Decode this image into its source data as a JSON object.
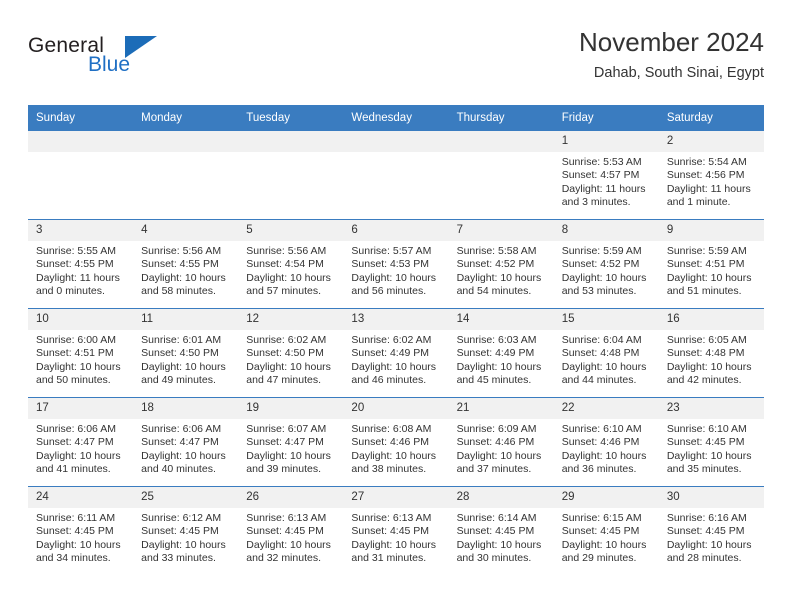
{
  "brand": {
    "name_part1": "General",
    "name_part2": "Blue",
    "accent_color": "#1c6cb8"
  },
  "header": {
    "title": "November 2024",
    "subtitle": "Dahab, South Sinai, Egypt"
  },
  "calendar": {
    "header_bg": "#3a7cc0",
    "daynum_bg": "#f1f1f1",
    "weekdays": [
      "Sunday",
      "Monday",
      "Tuesday",
      "Wednesday",
      "Thursday",
      "Friday",
      "Saturday"
    ],
    "weeks": [
      [
        {
          "day": "",
          "sunrise": "",
          "sunset": "",
          "daylight1": "",
          "daylight2": ""
        },
        {
          "day": "",
          "sunrise": "",
          "sunset": "",
          "daylight1": "",
          "daylight2": ""
        },
        {
          "day": "",
          "sunrise": "",
          "sunset": "",
          "daylight1": "",
          "daylight2": ""
        },
        {
          "day": "",
          "sunrise": "",
          "sunset": "",
          "daylight1": "",
          "daylight2": ""
        },
        {
          "day": "",
          "sunrise": "",
          "sunset": "",
          "daylight1": "",
          "daylight2": ""
        },
        {
          "day": "1",
          "sunrise": "Sunrise: 5:53 AM",
          "sunset": "Sunset: 4:57 PM",
          "daylight1": "Daylight: 11 hours",
          "daylight2": "and 3 minutes."
        },
        {
          "day": "2",
          "sunrise": "Sunrise: 5:54 AM",
          "sunset": "Sunset: 4:56 PM",
          "daylight1": "Daylight: 11 hours",
          "daylight2": "and 1 minute."
        }
      ],
      [
        {
          "day": "3",
          "sunrise": "Sunrise: 5:55 AM",
          "sunset": "Sunset: 4:55 PM",
          "daylight1": "Daylight: 11 hours",
          "daylight2": "and 0 minutes."
        },
        {
          "day": "4",
          "sunrise": "Sunrise: 5:56 AM",
          "sunset": "Sunset: 4:55 PM",
          "daylight1": "Daylight: 10 hours",
          "daylight2": "and 58 minutes."
        },
        {
          "day": "5",
          "sunrise": "Sunrise: 5:56 AM",
          "sunset": "Sunset: 4:54 PM",
          "daylight1": "Daylight: 10 hours",
          "daylight2": "and 57 minutes."
        },
        {
          "day": "6",
          "sunrise": "Sunrise: 5:57 AM",
          "sunset": "Sunset: 4:53 PM",
          "daylight1": "Daylight: 10 hours",
          "daylight2": "and 56 minutes."
        },
        {
          "day": "7",
          "sunrise": "Sunrise: 5:58 AM",
          "sunset": "Sunset: 4:52 PM",
          "daylight1": "Daylight: 10 hours",
          "daylight2": "and 54 minutes."
        },
        {
          "day": "8",
          "sunrise": "Sunrise: 5:59 AM",
          "sunset": "Sunset: 4:52 PM",
          "daylight1": "Daylight: 10 hours",
          "daylight2": "and 53 minutes."
        },
        {
          "day": "9",
          "sunrise": "Sunrise: 5:59 AM",
          "sunset": "Sunset: 4:51 PM",
          "daylight1": "Daylight: 10 hours",
          "daylight2": "and 51 minutes."
        }
      ],
      [
        {
          "day": "10",
          "sunrise": "Sunrise: 6:00 AM",
          "sunset": "Sunset: 4:51 PM",
          "daylight1": "Daylight: 10 hours",
          "daylight2": "and 50 minutes."
        },
        {
          "day": "11",
          "sunrise": "Sunrise: 6:01 AM",
          "sunset": "Sunset: 4:50 PM",
          "daylight1": "Daylight: 10 hours",
          "daylight2": "and 49 minutes."
        },
        {
          "day": "12",
          "sunrise": "Sunrise: 6:02 AM",
          "sunset": "Sunset: 4:50 PM",
          "daylight1": "Daylight: 10 hours",
          "daylight2": "and 47 minutes."
        },
        {
          "day": "13",
          "sunrise": "Sunrise: 6:02 AM",
          "sunset": "Sunset: 4:49 PM",
          "daylight1": "Daylight: 10 hours",
          "daylight2": "and 46 minutes."
        },
        {
          "day": "14",
          "sunrise": "Sunrise: 6:03 AM",
          "sunset": "Sunset: 4:49 PM",
          "daylight1": "Daylight: 10 hours",
          "daylight2": "and 45 minutes."
        },
        {
          "day": "15",
          "sunrise": "Sunrise: 6:04 AM",
          "sunset": "Sunset: 4:48 PM",
          "daylight1": "Daylight: 10 hours",
          "daylight2": "and 44 minutes."
        },
        {
          "day": "16",
          "sunrise": "Sunrise: 6:05 AM",
          "sunset": "Sunset: 4:48 PM",
          "daylight1": "Daylight: 10 hours",
          "daylight2": "and 42 minutes."
        }
      ],
      [
        {
          "day": "17",
          "sunrise": "Sunrise: 6:06 AM",
          "sunset": "Sunset: 4:47 PM",
          "daylight1": "Daylight: 10 hours",
          "daylight2": "and 41 minutes."
        },
        {
          "day": "18",
          "sunrise": "Sunrise: 6:06 AM",
          "sunset": "Sunset: 4:47 PM",
          "daylight1": "Daylight: 10 hours",
          "daylight2": "and 40 minutes."
        },
        {
          "day": "19",
          "sunrise": "Sunrise: 6:07 AM",
          "sunset": "Sunset: 4:47 PM",
          "daylight1": "Daylight: 10 hours",
          "daylight2": "and 39 minutes."
        },
        {
          "day": "20",
          "sunrise": "Sunrise: 6:08 AM",
          "sunset": "Sunset: 4:46 PM",
          "daylight1": "Daylight: 10 hours",
          "daylight2": "and 38 minutes."
        },
        {
          "day": "21",
          "sunrise": "Sunrise: 6:09 AM",
          "sunset": "Sunset: 4:46 PM",
          "daylight1": "Daylight: 10 hours",
          "daylight2": "and 37 minutes."
        },
        {
          "day": "22",
          "sunrise": "Sunrise: 6:10 AM",
          "sunset": "Sunset: 4:46 PM",
          "daylight1": "Daylight: 10 hours",
          "daylight2": "and 36 minutes."
        },
        {
          "day": "23",
          "sunrise": "Sunrise: 6:10 AM",
          "sunset": "Sunset: 4:45 PM",
          "daylight1": "Daylight: 10 hours",
          "daylight2": "and 35 minutes."
        }
      ],
      [
        {
          "day": "24",
          "sunrise": "Sunrise: 6:11 AM",
          "sunset": "Sunset: 4:45 PM",
          "daylight1": "Daylight: 10 hours",
          "daylight2": "and 34 minutes."
        },
        {
          "day": "25",
          "sunrise": "Sunrise: 6:12 AM",
          "sunset": "Sunset: 4:45 PM",
          "daylight1": "Daylight: 10 hours",
          "daylight2": "and 33 minutes."
        },
        {
          "day": "26",
          "sunrise": "Sunrise: 6:13 AM",
          "sunset": "Sunset: 4:45 PM",
          "daylight1": "Daylight: 10 hours",
          "daylight2": "and 32 minutes."
        },
        {
          "day": "27",
          "sunrise": "Sunrise: 6:13 AM",
          "sunset": "Sunset: 4:45 PM",
          "daylight1": "Daylight: 10 hours",
          "daylight2": "and 31 minutes."
        },
        {
          "day": "28",
          "sunrise": "Sunrise: 6:14 AM",
          "sunset": "Sunset: 4:45 PM",
          "daylight1": "Daylight: 10 hours",
          "daylight2": "and 30 minutes."
        },
        {
          "day": "29",
          "sunrise": "Sunrise: 6:15 AM",
          "sunset": "Sunset: 4:45 PM",
          "daylight1": "Daylight: 10 hours",
          "daylight2": "and 29 minutes."
        },
        {
          "day": "30",
          "sunrise": "Sunrise: 6:16 AM",
          "sunset": "Sunset: 4:45 PM",
          "daylight1": "Daylight: 10 hours",
          "daylight2": "and 28 minutes."
        }
      ]
    ]
  }
}
